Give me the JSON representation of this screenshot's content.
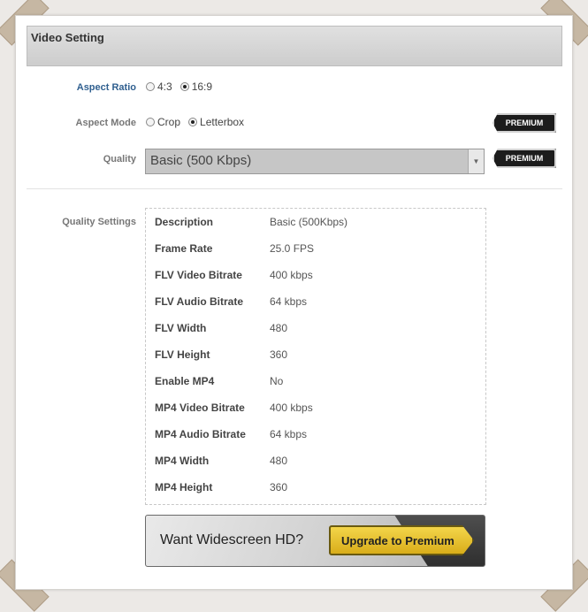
{
  "header": {
    "title": "Video Setting"
  },
  "aspect_ratio": {
    "label": "Aspect Ratio",
    "options": [
      {
        "label": "4:3",
        "selected": false
      },
      {
        "label": "16:9",
        "selected": true
      }
    ]
  },
  "aspect_mode": {
    "label": "Aspect Mode",
    "options": [
      {
        "label": "Crop",
        "selected": false
      },
      {
        "label": "Letterbox",
        "selected": true
      }
    ],
    "premium_label": "PREMIUM"
  },
  "quality": {
    "label": "Quality",
    "selected": "Basic (500 Kbps)",
    "premium_label": "PREMIUM"
  },
  "quality_settings": {
    "label": "Quality Settings",
    "rows": [
      {
        "key": "Description",
        "value": "Basic (500Kbps)"
      },
      {
        "key": "Frame Rate",
        "value": "25.0 FPS"
      },
      {
        "key": "FLV Video Bitrate",
        "value": "400 kbps"
      },
      {
        "key": "FLV Audio Bitrate",
        "value": "64 kbps"
      },
      {
        "key": "FLV Width",
        "value": "480"
      },
      {
        "key": "FLV Height",
        "value": "360"
      },
      {
        "key": "Enable MP4",
        "value": "No"
      },
      {
        "key": "MP4 Video Bitrate",
        "value": "400 kbps"
      },
      {
        "key": "MP4 Audio Bitrate",
        "value": "64 kbps"
      },
      {
        "key": "MP4 Width",
        "value": "480"
      },
      {
        "key": "MP4 Height",
        "value": "360"
      }
    ]
  },
  "banner": {
    "text": "Want Widescreen HD?",
    "button_label": "Upgrade to Premium"
  },
  "colors": {
    "accent_label": "#2f5f8f",
    "premium_badge": "#1c1c1c",
    "upgrade_button": "#e8c230"
  }
}
